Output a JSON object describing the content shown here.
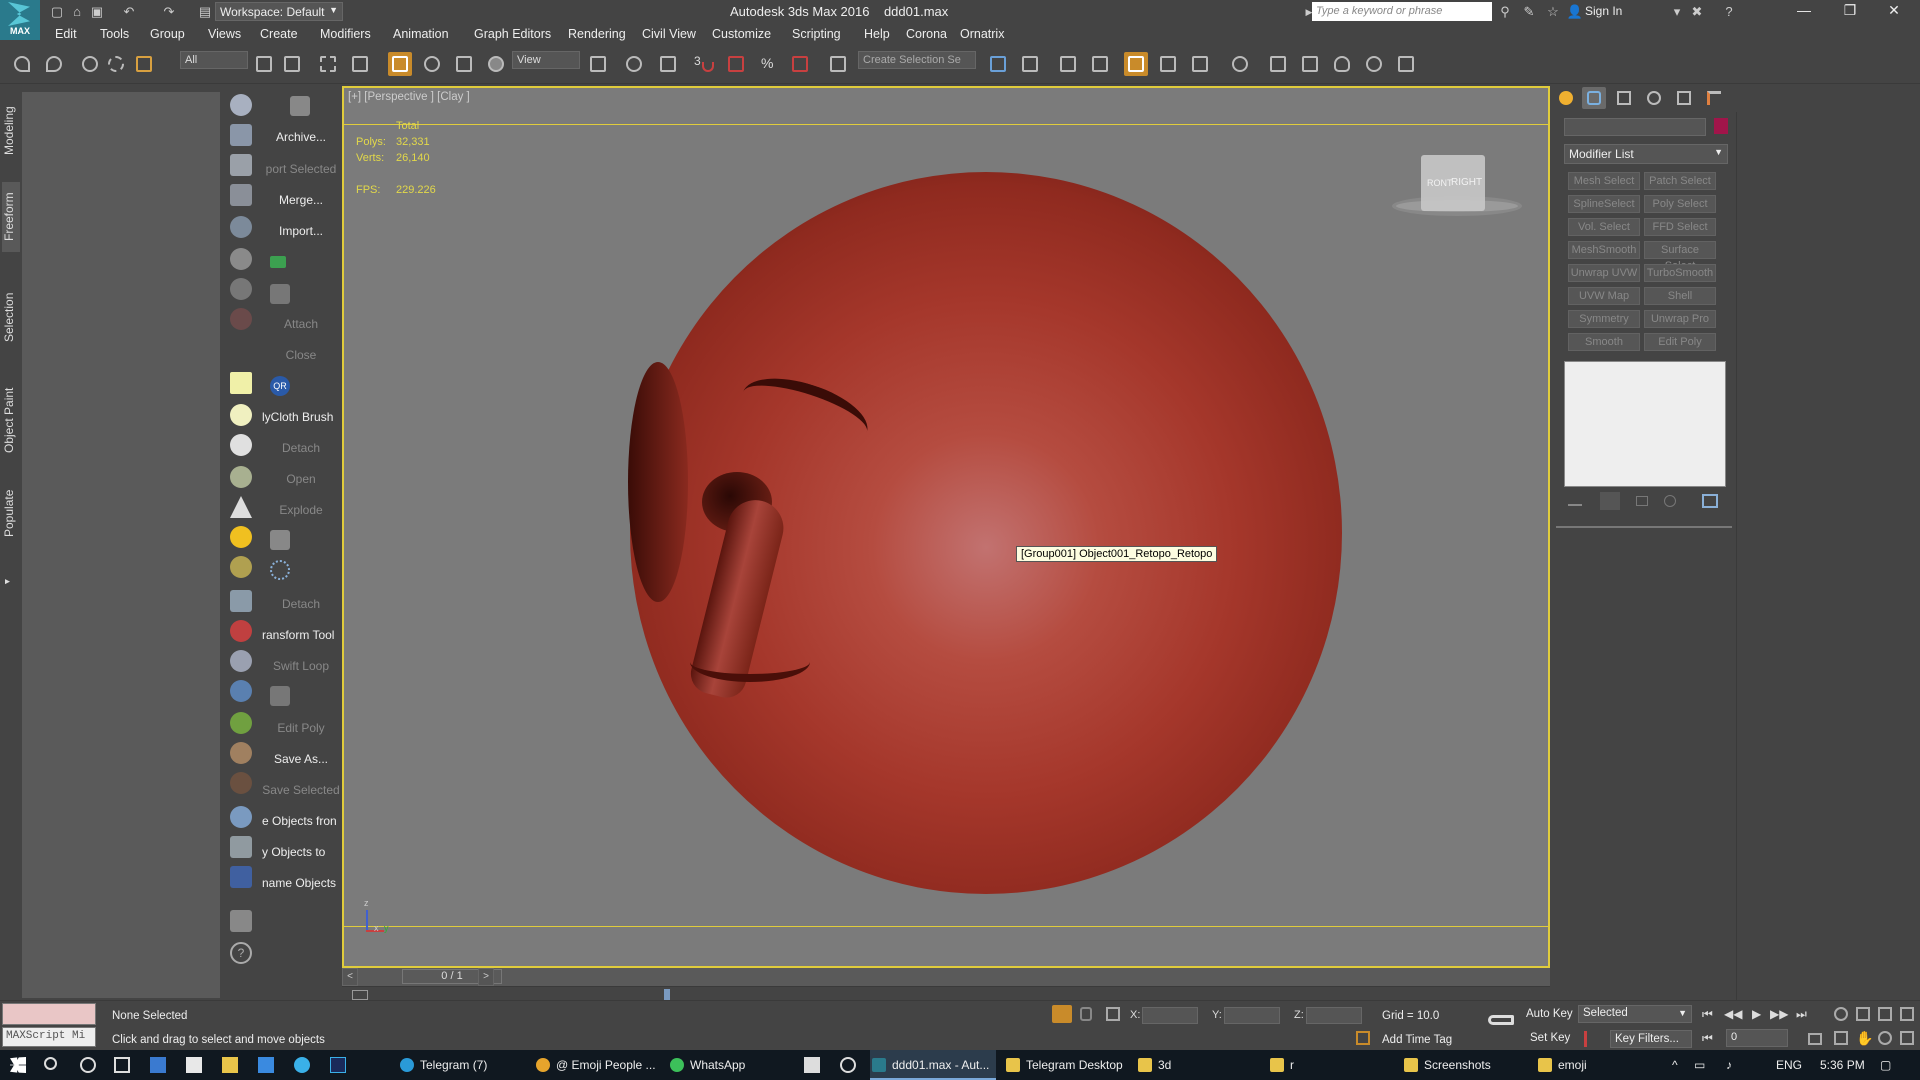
{
  "app": {
    "logo_label": "MAX",
    "workspace": "Workspace: Default",
    "title": "Autodesk 3ds Max 2016",
    "filename": "ddd01.max",
    "search_placeholder": "Type a keyword or phrase",
    "signin": "Sign In"
  },
  "menu": [
    "Edit",
    "Tools",
    "Group",
    "Views",
    "Create",
    "Modifiers",
    "Animation",
    "Graph Editors",
    "Rendering",
    "Civil View",
    "Customize",
    "Scripting",
    "Help",
    "Corona",
    "Ornatrix"
  ],
  "toolbar": {
    "filter_value": "All",
    "coord_system": "View",
    "selection_set_placeholder": "Create Selection Se",
    "snap_label": "3"
  },
  "ribbon_tabs": [
    "Modeling",
    "Freeform",
    "Selection",
    "Object Paint",
    "Populate"
  ],
  "ribbon_selected": "Freeform",
  "script_panel": [
    {
      "label": "Archive...",
      "dim": false
    },
    {
      "label": "port Selected",
      "dim": true
    },
    {
      "label": "Merge...",
      "dim": false
    },
    {
      "label": "Import...",
      "dim": false
    },
    {
      "label": "Attach",
      "dim": true
    },
    {
      "label": "Close",
      "dim": true
    },
    {
      "label": "lyCloth Brush",
      "dim": false
    },
    {
      "label": "Detach",
      "dim": true
    },
    {
      "label": "Open",
      "dim": true
    },
    {
      "label": "Explode",
      "dim": true
    },
    {
      "label": "Detach",
      "dim": true
    },
    {
      "label": "ransform Tool",
      "dim": false
    },
    {
      "label": "Swift Loop",
      "dim": true
    },
    {
      "label": "Edit Poly",
      "dim": true
    },
    {
      "label": "Save As...",
      "dim": false
    },
    {
      "label": "Save Selected",
      "dim": true
    },
    {
      "label": "e Objects fron",
      "dim": false
    },
    {
      "label": "y Objects to",
      "dim": false
    },
    {
      "label": "name Objects",
      "dim": false
    }
  ],
  "viewport": {
    "label": "[+] [Perspective ] [Clay ]",
    "stats": {
      "total_label": "Total",
      "polys_label": "Polys:",
      "polys": "32,331",
      "verts_label": "Verts:",
      "verts": "26,140",
      "fps_label": "FPS:",
      "fps": "229.226"
    },
    "tooltip": "[Group001] Object001_Retopo_Retopo",
    "viewcube_labels": [
      "RONT",
      "RIGHT"
    ],
    "axis_labels": [
      "z",
      "x",
      "y"
    ],
    "sphere_color": "#a5372b"
  },
  "timeslider": {
    "frame": "0 / 1",
    "prev": "<",
    "next": ">"
  },
  "command_panel": {
    "object_color": "#a1154a",
    "modifier_list": "Modifier List",
    "modifier_buttons": [
      [
        "Mesh Select",
        "Patch Select"
      ],
      [
        "SplineSelect",
        "Poly Select"
      ],
      [
        "Vol. Select",
        "FFD Select"
      ],
      [
        "MeshSmooth",
        "Surface Select"
      ],
      [
        "Unwrap UVW",
        "TurboSmooth"
      ],
      [
        "UVW Map",
        "Shell"
      ],
      [
        "Symmetry",
        "Unwrap Pro"
      ],
      [
        "Smooth",
        "Edit Poly"
      ]
    ]
  },
  "status": {
    "maxscript": "MAXScript Mi",
    "selection": "None Selected",
    "prompt": "Click and drag to select and move objects",
    "x_label": "X:",
    "y_label": "Y:",
    "z_label": "Z:",
    "grid": "Grid = 10.0",
    "add_time_tag": "Add Time Tag",
    "auto_key": "Auto Key",
    "set_key": "Set Key",
    "key_mode": "Selected",
    "key_filters": "Key Filters...",
    "frame_value": "0"
  },
  "taskbar": {
    "apps": [
      {
        "label": "Telegram (7)",
        "color": "#2a9ad8",
        "active": false
      },
      {
        "label": "@ Emoji People ...",
        "color": "#e6a42c",
        "active": false
      },
      {
        "label": "WhatsApp",
        "color": "#3cc05a",
        "active": false
      },
      {
        "label": "ddd01.max - Aut...",
        "color": "#2a7a8c",
        "active": true
      },
      {
        "label": "Telegram Desktop",
        "color": "#e8c44a",
        "active": false
      },
      {
        "label": "3d",
        "color": "#e8c44a",
        "active": false
      },
      {
        "label": "r",
        "color": "#e8c44a",
        "active": false
      },
      {
        "label": "Screenshots",
        "color": "#e8c44a",
        "active": false
      },
      {
        "label": "emoji",
        "color": "#e8c44a",
        "active": false
      }
    ],
    "language": "ENG",
    "time": "5:36 PM"
  }
}
